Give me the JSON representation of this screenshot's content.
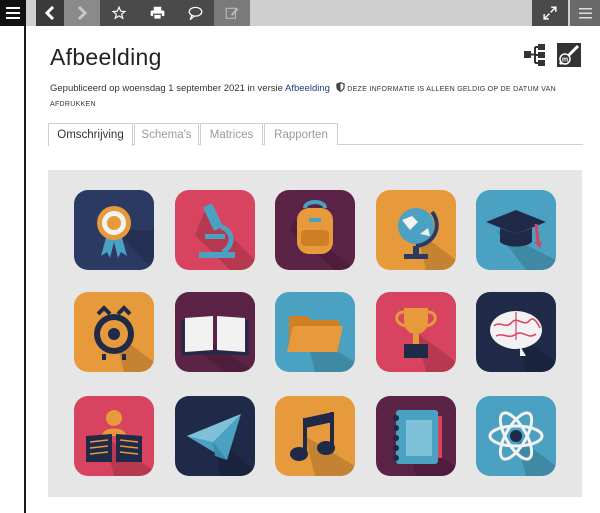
{
  "toolbar": {
    "menu_icon": "hamburger-icon",
    "back_icon": "chevron-left-icon",
    "forward_icon": "chevron-right-icon",
    "star_icon": "star-icon",
    "print_icon": "printer-icon",
    "comment_icon": "speech-bubble-icon",
    "edit_icon": "edit-icon",
    "expand_icon": "expand-icon",
    "list_icon": "list-icon"
  },
  "page": {
    "title": "Afbeelding",
    "meta_prefix": "Gepubliceerd op woensdag 1 september 2021 in versie",
    "meta_link": "Afbeelding",
    "meta_note": "Deze informatie is alleen geldig op de datum van afdrukken"
  },
  "tabs": [
    {
      "label": "Omschrijving",
      "active": true
    },
    {
      "label": "Schema's",
      "active": false
    },
    {
      "label": "Matrices",
      "active": false
    },
    {
      "label": "Rapporten",
      "active": false
    }
  ],
  "tiles": [
    {
      "name": "award-ribbon-icon",
      "color": "#2b3a63"
    },
    {
      "name": "microscope-icon",
      "color": "#d8435f"
    },
    {
      "name": "backpack-icon",
      "color": "#5b2346"
    },
    {
      "name": "globe-icon",
      "color": "#e79a3c"
    },
    {
      "name": "graduation-cap-icon",
      "color": "#4ba1c2"
    },
    {
      "name": "alarm-clock-icon",
      "color": "#e79a3c"
    },
    {
      "name": "open-book-icon",
      "color": "#5b2346"
    },
    {
      "name": "folder-icon",
      "color": "#4ba1c2"
    },
    {
      "name": "trophy-icon",
      "color": "#d8435f"
    },
    {
      "name": "brain-icon",
      "color": "#2b3a63"
    },
    {
      "name": "reader-icon",
      "color": "#d8435f"
    },
    {
      "name": "paper-plane-icon",
      "color": "#2b3a63"
    },
    {
      "name": "music-note-icon",
      "color": "#e79a3c"
    },
    {
      "name": "notebook-icon",
      "color": "#5b2346"
    },
    {
      "name": "atom-icon",
      "color": "#4ba1c2"
    }
  ]
}
